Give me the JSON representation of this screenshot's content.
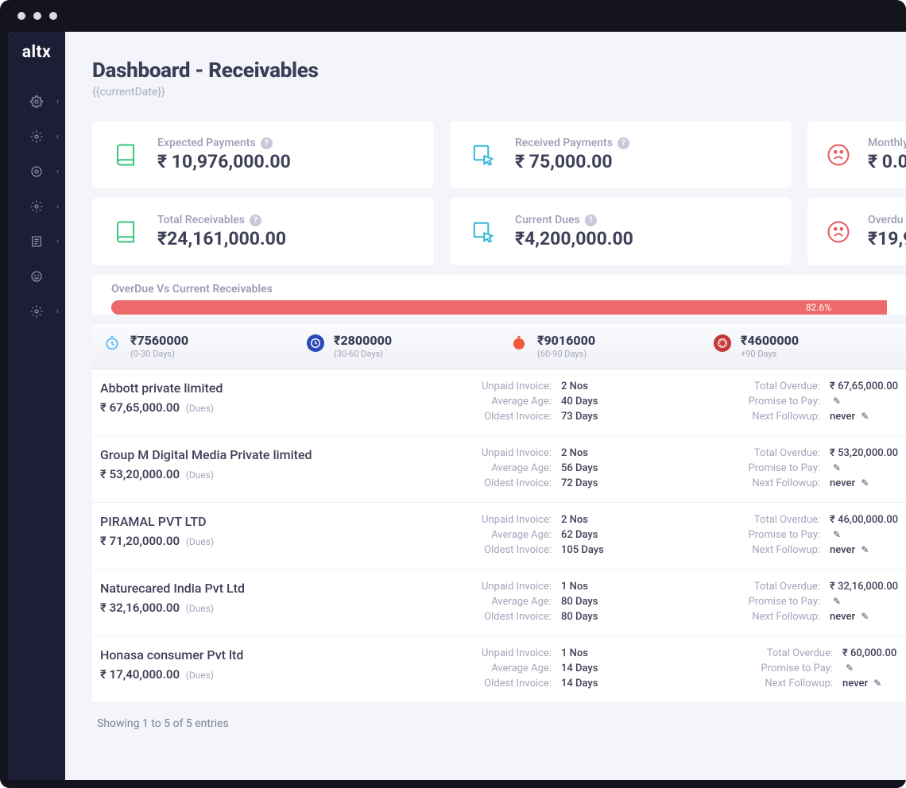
{
  "logo": "altx",
  "page": {
    "title": "Dashboard - Receivables",
    "subtitle": "{{currentDate}}"
  },
  "cards": {
    "expected": {
      "label": "Expected Payments",
      "value": "₹ 10,976,000.00"
    },
    "received": {
      "label": "Received Payments",
      "value": "₹ 75,000.00"
    },
    "monthly": {
      "label": "Monthly",
      "value": "₹ 0.0"
    },
    "total": {
      "label": "Total Receivables",
      "value": "₹24,161,000.00"
    },
    "current": {
      "label": "Current Dues",
      "value": "₹4,200,000.00"
    },
    "overdue": {
      "label": "Overdu",
      "value": "₹19,9"
    }
  },
  "progress": {
    "title": "OverDue Vs Current Receivables",
    "percent": "82.6%"
  },
  "aging": [
    {
      "amount": "₹7560000",
      "range": "(0-30 Days)",
      "color": "#4fb5ff"
    },
    {
      "amount": "₹2800000",
      "range": "(30-60 Days)",
      "color": "#2b49b8"
    },
    {
      "amount": "₹9016000",
      "range": "(60-90 Days)",
      "color": "#f05a3a"
    },
    {
      "amount": "₹4600000",
      "range": "+90 Days",
      "color": "#c43a3a"
    }
  ],
  "entries": [
    {
      "name": "Abbott private limited",
      "dues": "₹ 67,65,000.00",
      "unpaid": "2 Nos",
      "avg": "40 Days",
      "oldest": "73 Days",
      "total_overdue": "₹ 67,65,000.00",
      "followup": "never"
    },
    {
      "name": "Group M Digital Media Private limited",
      "dues": "₹ 53,20,000.00",
      "unpaid": "2 Nos",
      "avg": "56 Days",
      "oldest": "72 Days",
      "total_overdue": "₹ 53,20,000.00",
      "followup": "never"
    },
    {
      "name": "PIRAMAL PVT LTD",
      "dues": "₹ 71,20,000.00",
      "unpaid": "2 Nos",
      "avg": "62 Days",
      "oldest": "105 Days",
      "total_overdue": "₹ 46,00,000.00",
      "followup": "never"
    },
    {
      "name": "Naturecared India Pvt Ltd",
      "dues": "₹ 32,16,000.00",
      "unpaid": "1 Nos",
      "avg": "80 Days",
      "oldest": "80 Days",
      "total_overdue": "₹ 32,16,000.00",
      "followup": "never"
    },
    {
      "name": "Honasa consumer Pvt ltd",
      "dues": "₹ 17,40,000.00",
      "unpaid": "1 Nos",
      "avg": "14 Days",
      "oldest": "14 Days",
      "total_overdue": "₹ 60,000.00",
      "followup": "never"
    }
  ],
  "labels": {
    "dues_tag": "(Dues)",
    "unpaid": "Unpaid Invoice:",
    "avg": "Average Age:",
    "oldest": "Oldest Invoice:",
    "total_overdue": "Total Overdue:",
    "promise": "Promise to Pay:",
    "followup": "Next Followup:",
    "showing": "Showing 1 to 5 of 5 entries"
  }
}
